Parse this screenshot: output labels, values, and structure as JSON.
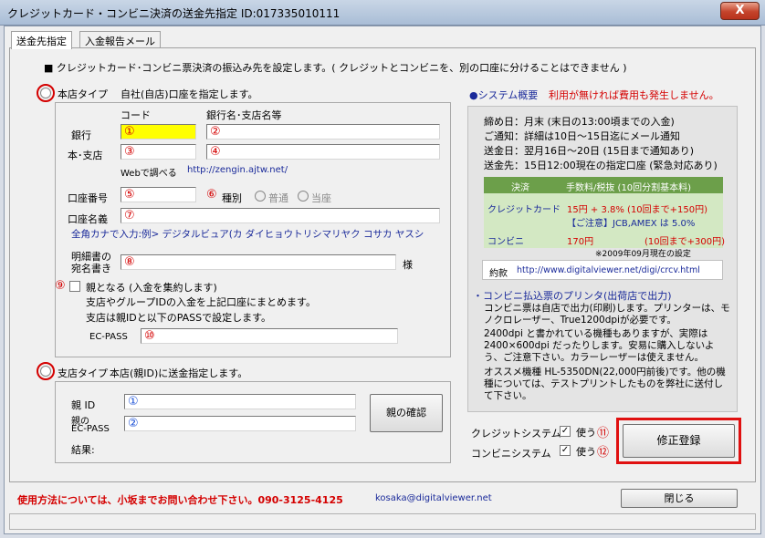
{
  "window": {
    "title": "クレジットカード・コンビニ決済の送金先指定 ID:017335010111",
    "close_label": "X"
  },
  "tabs": [
    {
      "label": "送金先指定"
    },
    {
      "label": "入金報告メール"
    }
  ],
  "notice": "■ クレジットカード･コンビニ票決済の振込み先を設定します。( クレジットとコンビニを、別の口座に分けることはできません )",
  "honten": {
    "radio_label": "本店タイプ",
    "description": "自社(自店)口座を指定します。",
    "col_code": "コード",
    "col_name": "銀行名･支店名等",
    "bank_label": "銀行",
    "branch_label": "本･支店",
    "web_lookup_label": "Webで調べる",
    "web_lookup_url": "http://zengin.ajtw.net/",
    "account_no_label": "口座番号",
    "kind_label": "種別",
    "kind_options": [
      "普通",
      "当座"
    ],
    "account_name_label": "口座名義",
    "hint": "全角カナで入力:例> デジタルビュア(カ ダイヒョウトリシマリヤク コサカ ヤスシ",
    "addressee_label_1": "明細書の",
    "addressee_label_2": "宛名書き",
    "addressee_suffix": "様",
    "parent_label": "親となる (入金を集約します)",
    "parent_desc_1": "支店やグループIDの入金を上記口座にまとめます。",
    "parent_desc_2": "支店は親IDと以下のPASSで設定します。",
    "ecpass_label": "EC-PASS"
  },
  "shiten": {
    "radio_label": "支店タイプ",
    "description": "本店(親ID)に送金指定します。",
    "parent_id_label": "親 ID",
    "parent_ecpass_label_1": "親の",
    "parent_ecpass_label_2": "EC-PASS",
    "confirm_button": "親の確認",
    "result_label": "結果:"
  },
  "annotations": {
    "n1": "①",
    "n2": "②",
    "n3": "③",
    "n4": "④",
    "n5": "⑤",
    "n6": "⑥",
    "n7": "⑦",
    "n8": "⑧",
    "n9": "⑨",
    "n10": "⑩",
    "n11": "⑪",
    "n12": "⑫"
  },
  "system": {
    "title": "●システム概要",
    "note": "利用が無ければ費用も発生しません。",
    "lines": [
      "締め日：月末 (末日の13:00頃までの入金)",
      "ご通知：詳細は10日～15日迄にメール通知",
      "送金日：翌月16日～20日 (15日まで通知あり)",
      "送金先：15日12:00現在の指定口座 (緊急対応あり)"
    ],
    "fee_header_1": "決済",
    "fee_header_2": "手数料/税抜 (10回分割基本料)",
    "credit_label": "クレジットカード",
    "credit_fee": "15円 + 3.8% (10回まで+150円)",
    "credit_note": "【ご注意】JCB,AMEX は 5.0%",
    "conv_label": "コンビニ",
    "conv_fee": "170円",
    "conv_fee_note": "(10回まで+300円)",
    "as_of": "※2009年09月現在の設定",
    "terms_label": "約款",
    "terms_url": "http://www.digitalviewer.net/digi/crcv.html",
    "printer_title": "・コンビニ払込票のプリンタ(出荷店で出力)",
    "printer_p1": "コンビニ票は自店で出力(印刷)します。プリンターは、モノクロレーザー、True1200dpiが必要です。",
    "printer_p2": "2400dpi と書かれている機種もありますが、実際は2400×600dpi だったりします。安易に購入しないよう、ご注意下さい。カラーレーザーは使えません。",
    "printer_p3": "オススメ機種 HL-5350DN(22,000円前後)です。他の機種については、テストプリントしたものを弊社に送付して下さい。"
  },
  "toggles": {
    "credit_system": "クレジットシステム",
    "conv_system": "コンビニシステム",
    "use_label": "使う"
  },
  "submit_button": "修正登録",
  "footer": {
    "contact": "使用方法については、小坂までお問い合わせ下さい。090-3125-4125",
    "email": "kosaka@digitalviewer.net",
    "close_button": "閉じる"
  },
  "colors": {
    "accent_red": "#d40000",
    "link_blue": "#1a2a9a",
    "fee_green": "#6c9f4a"
  }
}
